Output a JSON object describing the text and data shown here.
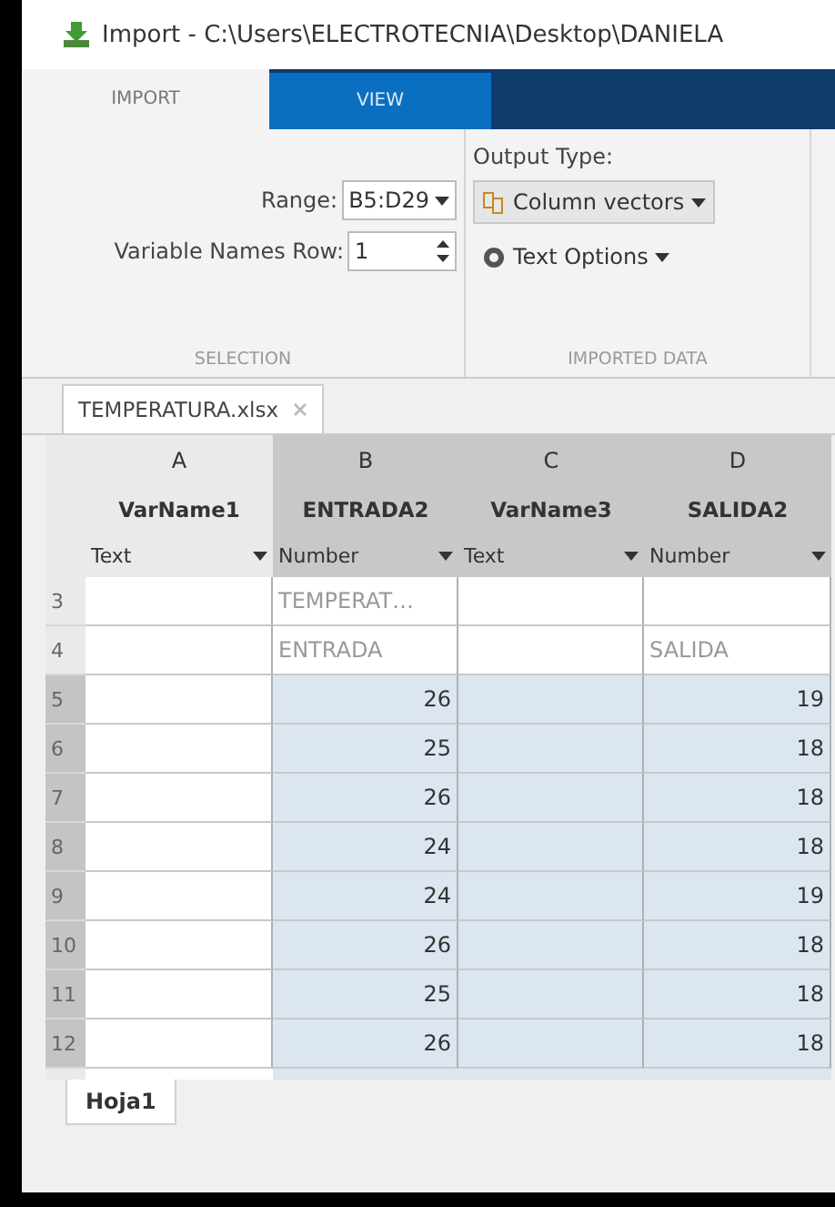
{
  "window": {
    "title": "Import - C:\\Users\\ELECTROTECNIA\\Desktop\\DANIELA"
  },
  "tabs": [
    {
      "label": "IMPORT",
      "selected": true
    },
    {
      "label": "VIEW",
      "selected": false
    }
  ],
  "selection": {
    "range_label": "Range:",
    "range_value": "B5:D29",
    "names_row_label": "Variable Names Row:",
    "names_row_value": "1",
    "group_label": "SELECTION"
  },
  "imported_data": {
    "output_type_label": "Output Type:",
    "output_type_value": "Column vectors",
    "text_options": "Text Options",
    "group_label": "IMPORTED DATA"
  },
  "file_tab": {
    "label": "TEMPERATURA.xlsx"
  },
  "table": {
    "columns": [
      {
        "letter": "A",
        "name": "VarName1",
        "type": "Text",
        "selected": false
      },
      {
        "letter": "B",
        "name": "ENTRADA2",
        "type": "Number",
        "selected": true
      },
      {
        "letter": "C",
        "name": "VarName3",
        "type": "Text",
        "selected": true
      },
      {
        "letter": "D",
        "name": "SALIDA2",
        "type": "Number",
        "selected": true
      }
    ],
    "rows": [
      {
        "number": "3",
        "selected": false,
        "cells": [
          null,
          "TEMPERAT…",
          null,
          null
        ]
      },
      {
        "number": "4",
        "selected": false,
        "cells": [
          null,
          "ENTRADA",
          null,
          "SALIDA"
        ]
      },
      {
        "number": "5",
        "selected": true,
        "cells": [
          null,
          "26",
          null,
          "19"
        ]
      },
      {
        "number": "6",
        "selected": true,
        "cells": [
          null,
          "25",
          null,
          "18"
        ]
      },
      {
        "number": "7",
        "selected": true,
        "cells": [
          null,
          "26",
          null,
          "18"
        ]
      },
      {
        "number": "8",
        "selected": true,
        "cells": [
          null,
          "24",
          null,
          "18"
        ]
      },
      {
        "number": "9",
        "selected": true,
        "cells": [
          null,
          "24",
          null,
          "19"
        ]
      },
      {
        "number": "10",
        "selected": true,
        "cells": [
          null,
          "26",
          null,
          "18"
        ]
      },
      {
        "number": "11",
        "selected": true,
        "cells": [
          null,
          "25",
          null,
          "18"
        ]
      },
      {
        "number": "12",
        "selected": true,
        "cells": [
          null,
          "26",
          null,
          "18"
        ]
      }
    ]
  },
  "sheet_tabs": [
    {
      "label": "Hoja1",
      "selected": true
    }
  ]
}
